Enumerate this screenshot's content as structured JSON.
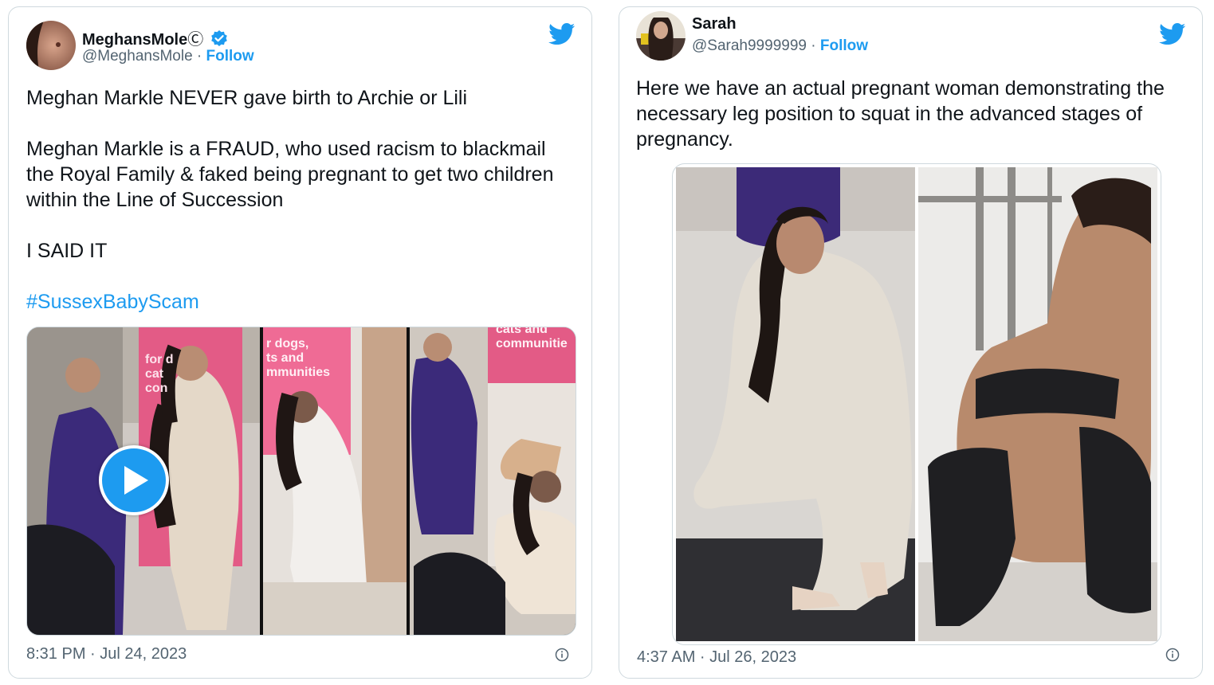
{
  "tweets": [
    {
      "author": {
        "name": "MeghansMole",
        "badge": "Ⓒ",
        "handle": "@MeghansMole",
        "separator": "·",
        "follow": "Follow"
      },
      "text": {
        "p1": "Meghan Markle NEVER gave birth to Archie or Lili",
        "p2": "Meghan Markle is a FRAUD, who used racism to blackmail the Royal Family & faked being pregnant to get two children within the Line of Succession",
        "p3": "I SAID IT",
        "hashtag": "#SussexBabyScam"
      },
      "media": {
        "type": "video",
        "frame_texts": [
          "for d",
          "cat",
          "con",
          "r dogs,",
          "ts and",
          "mmunities",
          "cats and",
          "communitie"
        ]
      },
      "timestamp": "8:31 PM · Jul 24, 2023"
    },
    {
      "author": {
        "name": "Sarah",
        "handle": "@Sarah9999999",
        "separator": "·",
        "follow": "Follow"
      },
      "text": {
        "p1": "Here we have an actual pregnant woman demonstrating the necessary leg position to squat in the advanced stages of pregnancy."
      },
      "media": {
        "type": "image",
        "panels": 2
      },
      "timestamp": "4:37 AM · Jul 26, 2023"
    }
  ],
  "icons": {
    "brand": "twitter-bird-icon",
    "verified": "verified-badge-icon",
    "info": "info-icon",
    "play": "play-icon"
  },
  "colors": {
    "accent": "#1d9bf0",
    "text": "#0f1419",
    "muted": "#536471",
    "border": "#cfd9de"
  }
}
